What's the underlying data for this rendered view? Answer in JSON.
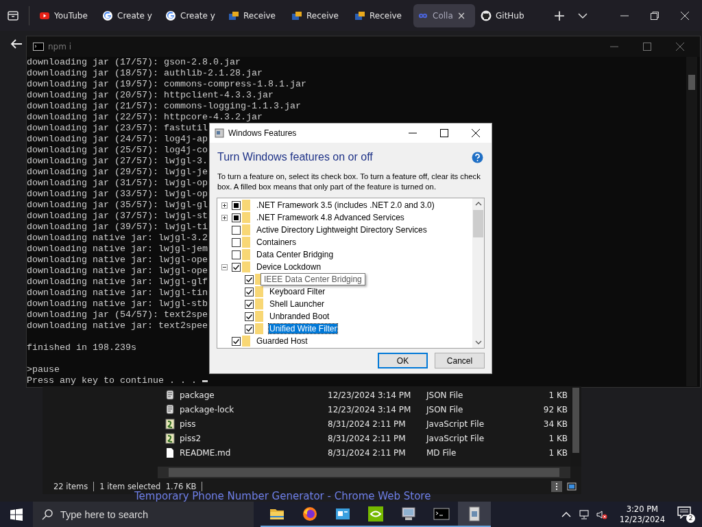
{
  "browser": {
    "tabs": [
      {
        "label": "YouTube",
        "kind": "video",
        "selected": false
      },
      {
        "label": "Create y",
        "kind": "search",
        "selected": false
      },
      {
        "label": "Create y",
        "kind": "search",
        "selected": false
      },
      {
        "label": "Receive",
        "kind": "mail",
        "selected": false
      },
      {
        "label": "Receive",
        "kind": "mail",
        "selected": false
      },
      {
        "label": "Receive",
        "kind": "mail",
        "selected": false
      },
      {
        "label": "Colla",
        "kind": "notebook",
        "selected": true,
        "close": "×"
      },
      {
        "label": "GitHub",
        "kind": "code",
        "selected": false
      }
    ],
    "new_tab": "+"
  },
  "console": {
    "title": "npm i",
    "lines": [
      "downloading jar (17/57): gson-2.8.0.jar",
      "downloading jar (18/57): authlib-2.1.28.jar",
      "downloading jar (19/57): commons-compress-1.8.1.jar",
      "downloading jar (20/57): httpclient-4.3.3.jar",
      "downloading jar (21/57): commons-logging-1.1.3.jar",
      "downloading jar (22/57): httpcore-4.3.2.jar",
      "downloading jar (23/57): fastutil",
      "downloading jar (24/57): log4j-ap",
      "downloading jar (25/57): log4j-co",
      "downloading jar (27/57): lwjgl-3.",
      "downloading jar (29/57): lwjgl-je",
      "downloading jar (31/57): lwjgl-op",
      "downloading jar (33/57): lwjgl-op",
      "downloading jar (35/57): lwjgl-gl",
      "downloading jar (37/57): lwjgl-st",
      "downloading jar (39/57): lwjgl-ti",
      "downloading native jar: lwjgl-3.2",
      "downloading native jar: lwjgl-jem",
      "downloading native jar: lwjgl-ope",
      "downloading native jar: lwjgl-ope",
      "downloading native jar: lwjgl-glf",
      "downloading native jar: lwjgl-tin",
      "downloading native jar: lwjgl-stb",
      "downloading jar (54/57): text2spe",
      "downloading native jar: text2spee"
    ],
    "result": "finished in 198.239s",
    "prompt": ">pause",
    "message": "Press any key to continue . . ."
  },
  "dialog": {
    "title": "Windows Features",
    "heading": "Turn Windows features on or off",
    "description": "To turn a feature on, select its check box. To turn a feature off, clear its check box. A filled box means that only part of the feature is turned on.",
    "features": [
      {
        "label": ".NET Framework 3.5 (includes .NET 2.0 and 3.0)",
        "expanded": false,
        "checked": false,
        "partial": true,
        "selected": false
      },
      {
        "label": ".NET Framework 4.8 Advanced Services",
        "expanded": false,
        "checked": false,
        "partial": true,
        "selected": false
      },
      {
        "label": "Active Directory Lightweight Directory Services",
        "checked": false,
        "selected": false
      },
      {
        "label": "Containers",
        "checked": false,
        "selected": false
      },
      {
        "label": "Data Center Bridging",
        "checked": false,
        "selected": false
      },
      {
        "label": "Device Lockdown",
        "expanded": true,
        "checked": true,
        "selected": false,
        "children": [
          {
            "label": "IEEE Data Center Bridging",
            "checked": true,
            "selected": false,
            "tooltip": true
          },
          {
            "label": "Keyboard Filter",
            "checked": true,
            "selected": false
          },
          {
            "label": "Shell Launcher",
            "checked": true,
            "selected": false
          },
          {
            "label": "Unbranded Boot",
            "checked": true,
            "selected": false
          },
          {
            "label": "Unified Write Filter",
            "checked": true,
            "selected": true
          }
        ]
      },
      {
        "label": "Guarded Host",
        "checked": true,
        "selected": false
      }
    ],
    "buttons": [
      {
        "label": "OK",
        "default": true
      },
      {
        "label": "Cancel",
        "default": false
      }
    ]
  },
  "explorer": {
    "files": [
      {
        "name": "package",
        "kind": "json",
        "date": "12/23/2024 3:14 PM",
        "type": "JSON File",
        "size": "1 KB"
      },
      {
        "name": "package-lock",
        "kind": "json",
        "date": "12/23/2024 3:14 PM",
        "type": "JSON File",
        "size": "92 KB"
      },
      {
        "name": "piss",
        "kind": "js",
        "date": "8/31/2024 2:11 PM",
        "type": "JavaScript File",
        "size": "34 KB"
      },
      {
        "name": "piss2",
        "kind": "js",
        "date": "8/31/2024 2:11 PM",
        "type": "JavaScript File",
        "size": "1 KB"
      },
      {
        "name": "README.md",
        "kind": "md",
        "date": "8/31/2024 2:11 PM",
        "type": "MD File",
        "size": "1 KB"
      }
    ],
    "item_count": "22 items",
    "selection": "1 item selected  1.76 KB"
  },
  "background_link": "Temporary Phone Number Generator - Chrome Web Store",
  "taskbar": {
    "search_placeholder": "Type here to search",
    "apps": [
      {
        "kind": "folder",
        "selected": false
      },
      {
        "kind": "browser",
        "selected": false
      },
      {
        "kind": "app",
        "selected": false
      },
      {
        "kind": "graphics",
        "selected": false
      },
      {
        "kind": "computer",
        "selected": false
      },
      {
        "kind": "terminal",
        "selected": false
      },
      {
        "kind": "features",
        "selected": true
      }
    ],
    "time": "3:20 PM",
    "date": "12/23/2024",
    "notifications": "2"
  }
}
